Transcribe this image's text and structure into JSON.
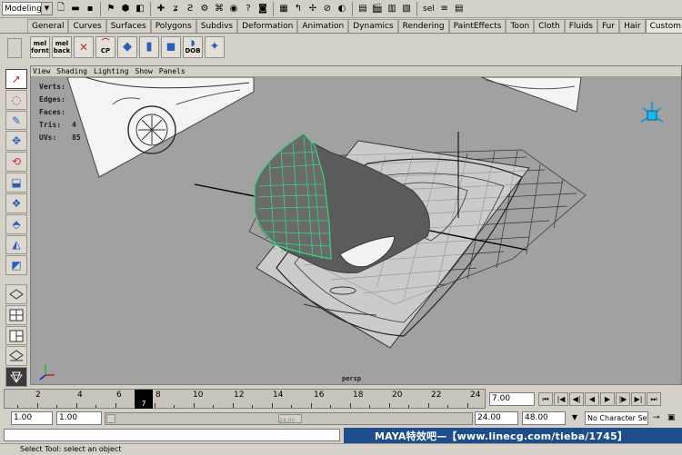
{
  "status_line": {
    "mode": "Modeling",
    "selection_field": "sel"
  },
  "shelf_tabs": [
    "General",
    "Curves",
    "Surfaces",
    "Polygons",
    "Subdivs",
    "Deformation",
    "Animation",
    "Dynamics",
    "Rendering",
    "PaintEffects",
    "Toon",
    "Cloth",
    "Fluids",
    "Fur",
    "Hair",
    "Custom"
  ],
  "active_shelf_tab": "Custom",
  "shelf_buttons": [
    {
      "top": "mel",
      "bottom": "fornt"
    },
    {
      "top": "mel",
      "bottom": "back"
    },
    {
      "top": "",
      "bottom": ""
    },
    {
      "top": "",
      "bottom": "CP"
    },
    {
      "top": "",
      "bottom": ""
    },
    {
      "top": "",
      "bottom": ""
    },
    {
      "top": "",
      "bottom": ""
    },
    {
      "top": "",
      "bottom": "DOB"
    },
    {
      "top": "",
      "bottom": ""
    }
  ],
  "panel_menu": [
    "View",
    "Shading",
    "Lighting",
    "Show",
    "Panels"
  ],
  "hud": [
    {
      "label": "Verts:",
      "value": ""
    },
    {
      "label": "Edges:",
      "value": ""
    },
    {
      "label": "Faces:",
      "value": ""
    },
    {
      "label": "Tris:",
      "value": "4"
    },
    {
      "label": "UVs:",
      "value": "85"
    }
  ],
  "camera_label": "persp",
  "time_slider": {
    "ticks": [
      "2",
      "4",
      "6",
      "8",
      "10",
      "12",
      "14",
      "16",
      "18",
      "20",
      "22",
      "24"
    ],
    "current_frame": "7"
  },
  "current_time": "7.00",
  "range": {
    "start": "1.00",
    "playback_start": "1.00",
    "playback_end": "24.00",
    "end": "48.00",
    "handle_label": "24.00"
  },
  "character_set": "No Character Set",
  "watermark": "MAYA特效吧—【www.linecg.com/tieba/1745】",
  "help_line": "Select Tool: select an object",
  "colors": {
    "ui_gray": "#d4d0c8",
    "viewport_bg": "#a1a1a1",
    "wire_green": "#35d87c",
    "watermark_bg": "#1d4d8a"
  }
}
